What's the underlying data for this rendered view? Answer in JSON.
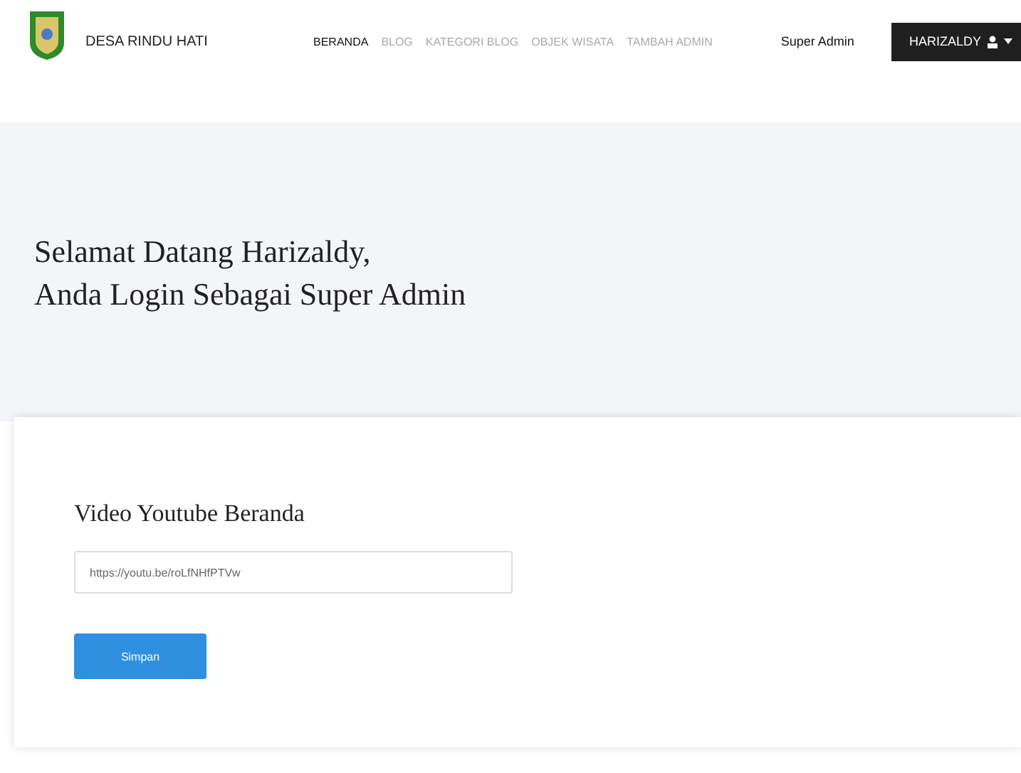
{
  "brand": {
    "name": "DESA RINDU HATI"
  },
  "nav": [
    {
      "label": "BERANDA",
      "selected": true
    },
    {
      "label": "BLOG",
      "selected": false
    },
    {
      "label": "KATEGORI BLOG",
      "selected": false
    },
    {
      "label": "OBJEK WISATA",
      "selected": false
    },
    {
      "label": "TAMBAH ADMIN",
      "selected": false
    }
  ],
  "role": "Super Admin",
  "user_menu": {
    "label": "HARIZALDY"
  },
  "welcome": [
    "Selamat Datang Harizaldy,",
    "Anda Login Sebagai Super Admin"
  ],
  "card": {
    "title": "Video Youtube Beranda",
    "field": {
      "value": "https://youtu.be/roLfNHfPTVw"
    },
    "button": "Simpan"
  }
}
